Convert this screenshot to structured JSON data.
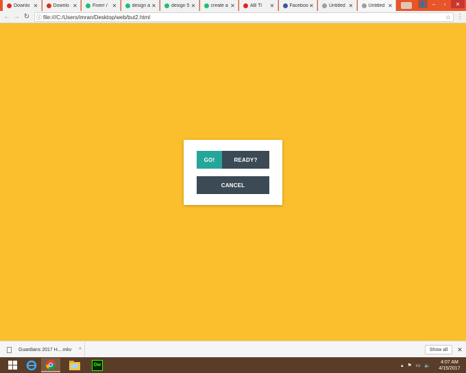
{
  "browser": {
    "tabs": [
      {
        "label": "Downlo",
        "icon": "gmail-icon",
        "color": "#d93025",
        "active": false
      },
      {
        "label": "Downlo",
        "icon": "gmail-icon",
        "color": "#d93025",
        "active": false
      },
      {
        "label": "Fiverr / ",
        "icon": "fiverr-icon",
        "color": "#1dbf73",
        "active": false
      },
      {
        "label": "design a",
        "icon": "fiverr-icon",
        "color": "#1dbf73",
        "active": false
      },
      {
        "label": "design 5",
        "icon": "fiverr-icon",
        "color": "#1dbf73",
        "active": false
      },
      {
        "label": "create a",
        "icon": "fiverr-icon",
        "color": "#1dbf73",
        "active": false
      },
      {
        "label": "AB Tl",
        "icon": "youtube-icon",
        "color": "#e62117",
        "active": false
      },
      {
        "label": "Faceboo",
        "icon": "facebook-icon",
        "color": "#3b5998",
        "active": false
      },
      {
        "label": "Untitled",
        "icon": "page-icon",
        "color": "#9e9e9e",
        "active": false
      },
      {
        "label": "Untitled",
        "icon": "page-icon",
        "color": "#9e9e9e",
        "active": true
      }
    ],
    "address_url": "file:///C:/Users/imran/Desktop/web/but2.html",
    "icons": {
      "back": "←",
      "forward": "→",
      "reload": "↻",
      "info": "ⓘ",
      "star": "☆",
      "menu": "⋮",
      "user": "👤",
      "minimize": "–",
      "maximize": "▫",
      "close": "✕"
    }
  },
  "page": {
    "background": "#fbbe2c",
    "go_label": "GO!",
    "ready_label": "READY?",
    "cancel_label": "CANCEL"
  },
  "downloads": {
    "filename": "Guardians 2017 H....mkv",
    "show_all_label": "Show all",
    "chevron": "^",
    "close": "✕"
  },
  "taskbar": {
    "apps": [
      "windows-start-icon",
      "internet-explorer-icon",
      "chrome-icon",
      "file-explorer-icon",
      "dreamweaver-icon"
    ],
    "dreamweaver_label": "Dw",
    "time": "4:07 AM",
    "date": "4/15/2017"
  }
}
